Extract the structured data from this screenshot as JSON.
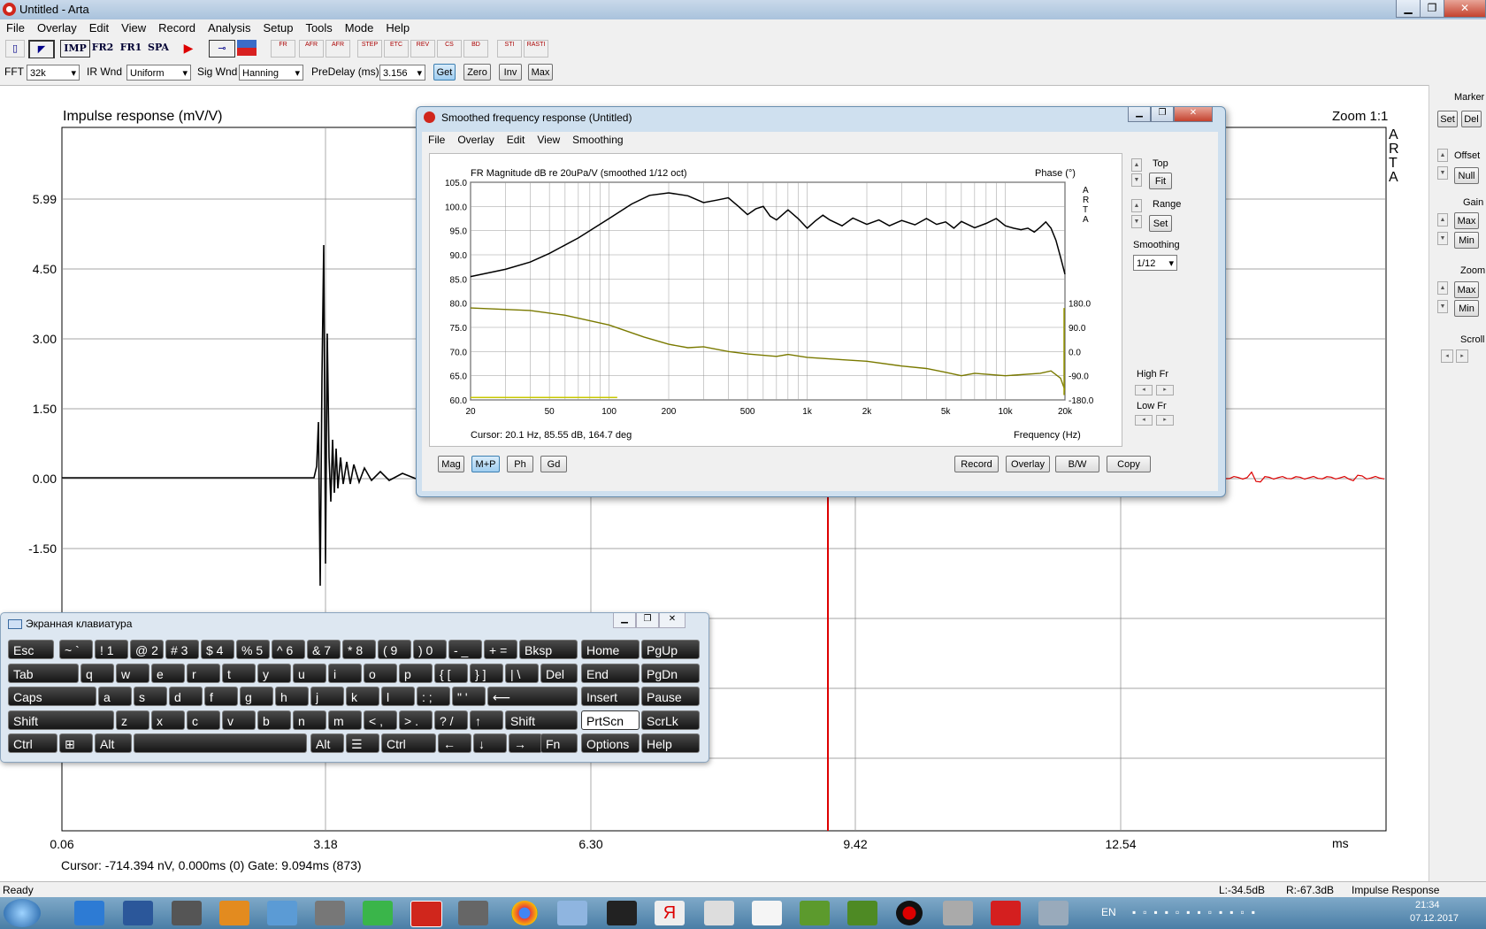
{
  "window": {
    "title": "Untitled - Arta"
  },
  "menu": [
    "File",
    "Overlay",
    "Edit",
    "View",
    "Record",
    "Analysis",
    "Setup",
    "Tools",
    "Mode",
    "Help"
  ],
  "toolbar": {
    "imp": "IMP",
    "fr2": "FR2",
    "fr1": "FR1",
    "spa": "SPA",
    "small_labels": [
      "FR",
      "AFR",
      "AFR",
      "STEP",
      "ETC",
      "REV",
      "CS",
      "BD",
      "STI",
      "RASTI"
    ]
  },
  "options": {
    "fft_label": "FFT",
    "fft_value": "32k",
    "irwnd_label": "IR Wnd",
    "irwnd_value": "Uniform",
    "sigwnd_label": "Sig Wnd",
    "sigwnd_value": "Hanning",
    "predelay_label": "PreDelay (ms)",
    "predelay_value": "3.156",
    "buttons": [
      "Get",
      "Zero",
      "Inv",
      "Max"
    ]
  },
  "main_plot": {
    "title": "Impulse response (mV/V)",
    "zoom": "Zoom 1:1",
    "arta": "A R T A",
    "y_ticks": [
      "5.99",
      "4.50",
      "3.00",
      "1.50",
      "0.00",
      "-1.50"
    ],
    "x_ticks": [
      "0.06",
      "3.18",
      "6.30",
      "9.42",
      "12.54"
    ],
    "x_unit": "ms",
    "cursor": "Cursor: -714.394 nV, 0.000ms (0)  Gate: 9.094ms (873)"
  },
  "right_panel": {
    "marker": "Marker",
    "set": "Set",
    "del": "Del",
    "offset": "Offset",
    "null": "Null",
    "gain": "Gain",
    "gain_max": "Max",
    "gain_min": "Min",
    "zoom": "Zoom",
    "zoom_max": "Max",
    "zoom_min": "Min",
    "scroll": "Scroll"
  },
  "dialog": {
    "title": "Smoothed frequency response (Untitled)",
    "menu": [
      "File",
      "Overlay",
      "Edit",
      "View",
      "Smoothing"
    ],
    "plot_title": "FR Magnitude dB re 20uPa/V (smoothed 1/12 oct)",
    "phase_label": "Phase (°)",
    "arta": "A R T A",
    "y_ticks": [
      "105.0",
      "100.0",
      "95.0",
      "90.0",
      "85.0",
      "80.0",
      "75.0",
      "70.0",
      "65.0",
      "60.0"
    ],
    "phase_ticks": [
      "180.0",
      "90.0",
      "0.0",
      "-90.0",
      "-180.0"
    ],
    "x_ticks": [
      "20",
      "50",
      "100",
      "200",
      "500",
      "1k",
      "2k",
      "5k",
      "10k",
      "20k"
    ],
    "x_unit": "Frequency (Hz)",
    "cursor": "Cursor: 20.1 Hz, 85.55 dB, 164.7 deg",
    "side": {
      "top": "Top",
      "fit": "Fit",
      "range": "Range",
      "set": "Set",
      "smoothing": "Smoothing",
      "smoothing_value": "1/12",
      "high": "High Fr",
      "low": "Low Fr"
    },
    "bottom_left": [
      "Mag",
      "M+P",
      "Ph",
      "Gd"
    ],
    "bottom_right": [
      "Record",
      "Overlay",
      "B/W",
      "Copy"
    ]
  },
  "keyboard": {
    "title": "Экранная клавиатура",
    "rows": [
      [
        [
          "Esc",
          8,
          52
        ],
        [
          "~ `",
          66,
          38
        ],
        [
          "! 1",
          106,
          38
        ],
        [
          "@ 2",
          146,
          38
        ],
        [
          "# 3",
          186,
          38
        ],
        [
          "$ 4",
          226,
          38
        ],
        [
          "% 5",
          266,
          38
        ],
        [
          "^ 6",
          306,
          38
        ],
        [
          "& 7",
          346,
          38
        ],
        [
          "* 8",
          386,
          38
        ],
        [
          "( 9",
          426,
          38
        ],
        [
          ") 0",
          466,
          38
        ],
        [
          "- _",
          506,
          38
        ],
        [
          "+ =",
          546,
          38
        ],
        [
          "Bksp",
          586,
          66
        ],
        [
          "Home",
          656,
          66
        ],
        [
          "PgUp",
          724,
          66
        ]
      ],
      [
        [
          "Tab",
          8,
          80
        ],
        [
          "q",
          90,
          38
        ],
        [
          "w",
          130,
          38
        ],
        [
          "e",
          170,
          38
        ],
        [
          "r",
          210,
          38
        ],
        [
          "t",
          250,
          38
        ],
        [
          "y",
          290,
          38
        ],
        [
          "u",
          330,
          38
        ],
        [
          "i",
          370,
          38
        ],
        [
          "o",
          410,
          38
        ],
        [
          "p",
          450,
          38
        ],
        [
          "{ [",
          490,
          38
        ],
        [
          "} ]",
          530,
          38
        ],
        [
          "| \\",
          570,
          38
        ],
        [
          "Del",
          610,
          42
        ],
        [
          "End",
          656,
          66
        ],
        [
          "PgDn",
          724,
          66
        ]
      ],
      [
        [
          "Caps",
          8,
          100
        ],
        [
          "a",
          110,
          38
        ],
        [
          "s",
          150,
          38
        ],
        [
          "d",
          190,
          38
        ],
        [
          "f",
          230,
          38
        ],
        [
          "g",
          270,
          38
        ],
        [
          "h",
          310,
          38
        ],
        [
          "j",
          350,
          38
        ],
        [
          "k",
          390,
          38
        ],
        [
          "l",
          430,
          38
        ],
        [
          ": ;",
          470,
          38
        ],
        [
          "\" '",
          510,
          38
        ],
        [
          "⟵",
          550,
          102
        ],
        [
          "Insert",
          656,
          66
        ],
        [
          "Pause",
          724,
          66
        ]
      ],
      [
        [
          "Shift",
          8,
          120
        ],
        [
          "z",
          130,
          38
        ],
        [
          "x",
          170,
          38
        ],
        [
          "c",
          210,
          38
        ],
        [
          "v",
          250,
          38
        ],
        [
          "b",
          290,
          38
        ],
        [
          "n",
          330,
          38
        ],
        [
          "m",
          370,
          38
        ],
        [
          "< ,",
          410,
          38
        ],
        [
          "> .",
          450,
          38
        ],
        [
          "? /",
          490,
          38
        ],
        [
          "↑",
          530,
          38
        ],
        [
          "Shift",
          570,
          82
        ],
        [
          "PrtScn",
          656,
          66
        ],
        [
          "ScrLk",
          724,
          66
        ]
      ],
      [
        [
          "Ctrl",
          8,
          56
        ],
        [
          "⊞",
          66,
          38
        ],
        [
          "Alt",
          106,
          42
        ],
        [
          "",
          150,
          196
        ],
        [
          "Alt",
          350,
          38
        ],
        [
          "☰",
          390,
          38
        ],
        [
          "Ctrl",
          430,
          62
        ],
        [
          "←",
          494,
          38
        ],
        [
          "↓",
          534,
          38
        ],
        [
          "→",
          574,
          38
        ],
        [
          "Fn",
          610,
          42
        ],
        [
          "Options",
          656,
          66
        ],
        [
          "Help",
          724,
          66
        ]
      ]
    ]
  },
  "status": {
    "ready": "Ready",
    "left": "L:-34.5dB",
    "right": "R:-67.3dB",
    "mode": "Impulse Response"
  },
  "taskbar": {
    "lang": "EN",
    "time": "21:34",
    "date": "07.12.2017"
  }
}
